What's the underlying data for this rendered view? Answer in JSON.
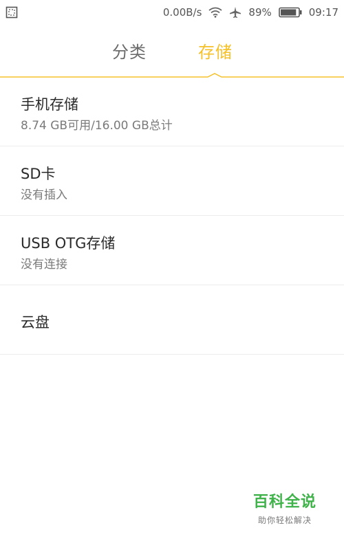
{
  "status_bar": {
    "speed": "0.00B/s",
    "battery_percent": "89%",
    "time": "09:17",
    "icons": [
      "screenshot-icon",
      "wifi-icon",
      "airplane-icon",
      "battery-icon"
    ],
    "battery_level": 0.89
  },
  "tabs": [
    {
      "label": "分类",
      "active": false
    },
    {
      "label": "存储",
      "active": true
    }
  ],
  "accent_color": "#f5c028",
  "storage_items": [
    {
      "title": "手机存储",
      "subtitle": "8.74 GB可用/16.00 GB总计"
    },
    {
      "title": "SD卡",
      "subtitle": "没有插入"
    },
    {
      "title": "USB OTG存储",
      "subtitle": "没有连接"
    },
    {
      "title": "云盘",
      "subtitle": ""
    }
  ],
  "watermark": {
    "title": "百科全说",
    "subtitle": "助你轻松解决"
  }
}
